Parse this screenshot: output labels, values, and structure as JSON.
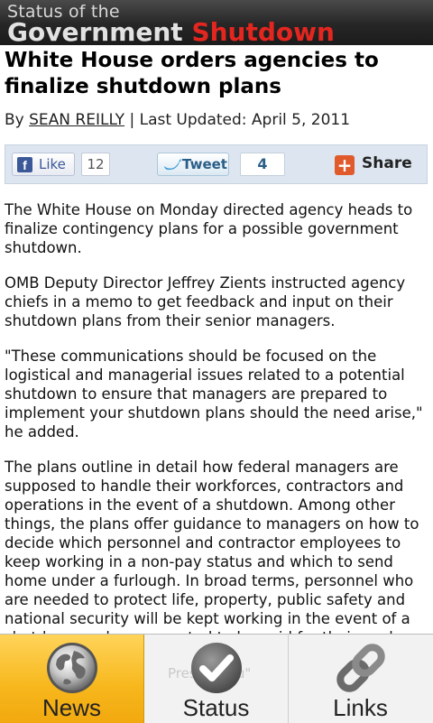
{
  "header": {
    "title_line1": "Status of the",
    "title_word1": "Government",
    "title_word2": "Shutdown"
  },
  "article": {
    "headline": "White House orders agencies to finalize shutdown plans",
    "byline_prefix": "By",
    "author": "SEAN REILLY",
    "separator": "|",
    "updated": "Last Updated: April 5, 2011",
    "paragraphs": [
      "The White House on Monday directed agency heads to finalize contingency plans for a possible government shutdown.",
      "OMB Deputy Director Jeffrey Zients instructed agency chiefs in a memo to get feedback and input on their shutdown plans from their senior managers.",
      "\"These communications should be focused on the logistical and managerial issues related to a potential shutdown to ensure that managers are prepared to implement your shutdown plans should the need arise,\" he added.",
      "The plans outline in detail how federal managers are supposed to handle their workforces, contractors and operations in the event of a shutdown. Among other things, the plans offer guidance to managers on how to decide which personnel and contractor employees to keep working in a non-pay status and which to send home under a furlough. In broad terms, personnel who are needed to protect life, property, public safety and national security will be kept working in the event of a shutdown and are expected to be paid for their work."
    ]
  },
  "sharebar": {
    "like_label": "Like",
    "like_count": "12",
    "tweet_label": "Tweet",
    "tweet_count": "4",
    "share_label": "Share",
    "share_glyph": "+"
  },
  "tabbar": {
    "ghost_text": "Press Menu\"",
    "tabs": [
      {
        "label": "News",
        "icon": "globe-icon",
        "active": true
      },
      {
        "label": "Status",
        "icon": "checkmark-icon",
        "active": false
      },
      {
        "label": "Links",
        "icon": "chain-link-icon",
        "active": false
      }
    ]
  },
  "colors": {
    "shutdown_red": "#e3261f",
    "active_tab": "#f7b71c",
    "facebook_blue": "#3b5998"
  }
}
